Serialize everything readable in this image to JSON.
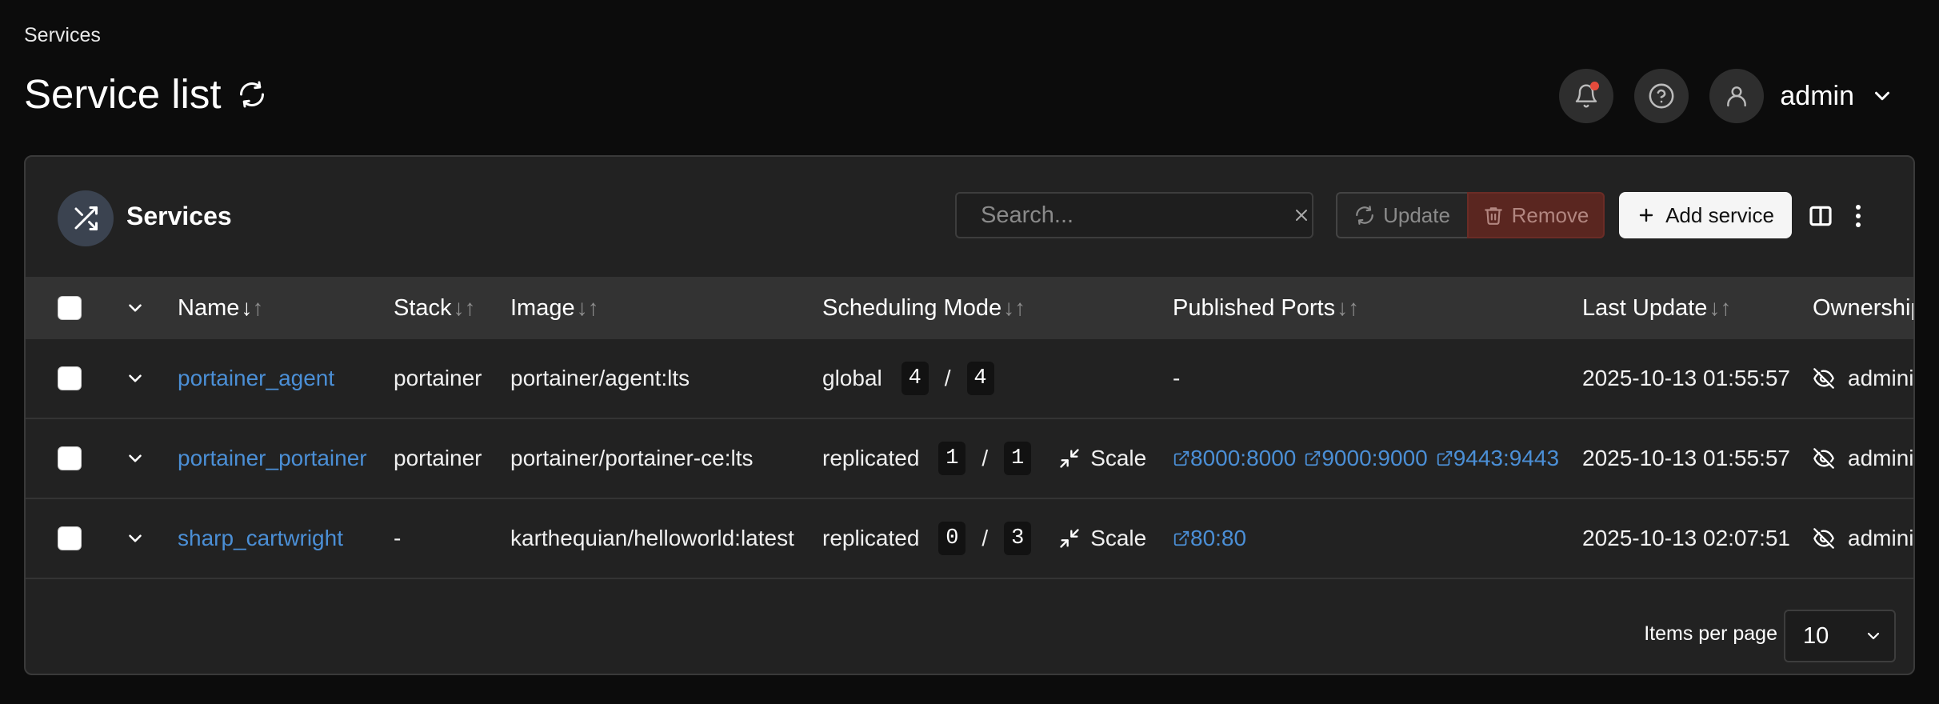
{
  "breadcrumb": "Services",
  "page_title": "Service list",
  "user": {
    "name": "admin"
  },
  "panel": {
    "title": "Services",
    "search_placeholder": "Search...",
    "update_label": "Update",
    "remove_label": "Remove",
    "add_label": "Add service"
  },
  "columns": {
    "name": "Name",
    "stack": "Stack",
    "image": "Image",
    "scheduling": "Scheduling Mode",
    "ports": "Published Ports",
    "last_update": "Last Update",
    "ownership": "Ownership"
  },
  "sort_glyphs": {
    "down": "↓",
    "up": "↑"
  },
  "rows": [
    {
      "name": "portainer_agent",
      "stack": "portainer",
      "image": "portainer/agent:lts",
      "mode": "global",
      "running": "4",
      "sep": "/",
      "desired": "4",
      "scale": "",
      "ports": [],
      "ports_empty": "-",
      "last_update": "2025-10-13 01:55:57",
      "ownership": "administrators"
    },
    {
      "name": "portainer_portainer",
      "stack": "portainer",
      "image": "portainer/portainer-ce:lts",
      "mode": "replicated",
      "running": "1",
      "sep": "/",
      "desired": "1",
      "scale": "Scale",
      "ports": [
        "8000:8000",
        "9000:9000",
        "9443:9443"
      ],
      "ports_empty": "",
      "last_update": "2025-10-13 01:55:57",
      "ownership": "administrators"
    },
    {
      "name": "sharp_cartwright",
      "stack": "-",
      "image": "karthequian/helloworld:latest",
      "mode": "replicated",
      "running": "0",
      "sep": "/",
      "desired": "3",
      "scale": "Scale",
      "ports": [
        "80:80"
      ],
      "ports_empty": "",
      "last_update": "2025-10-13 02:07:51",
      "ownership": "administrators"
    }
  ],
  "footer": {
    "items_per_page_label": "Items per page",
    "items_per_page": "10"
  },
  "icons": {
    "refresh": "refresh-icon",
    "bell": "bell-icon",
    "help": "help-circle-icon",
    "user": "user-icon",
    "shuffle": "shuffle-icon",
    "search": "search-icon",
    "close": "close-icon",
    "trash": "trash-icon",
    "plus": "plus-icon",
    "columns": "columns-icon",
    "more": "more-vertical-icon",
    "chevron": "chevron-down-icon",
    "external": "external-link-icon",
    "eye_off": "eye-off-icon",
    "minimize": "minimize-icon"
  },
  "colors": {
    "link": "#4b8fd6",
    "danger": "#5a2620",
    "notification": "#e54b3c"
  }
}
